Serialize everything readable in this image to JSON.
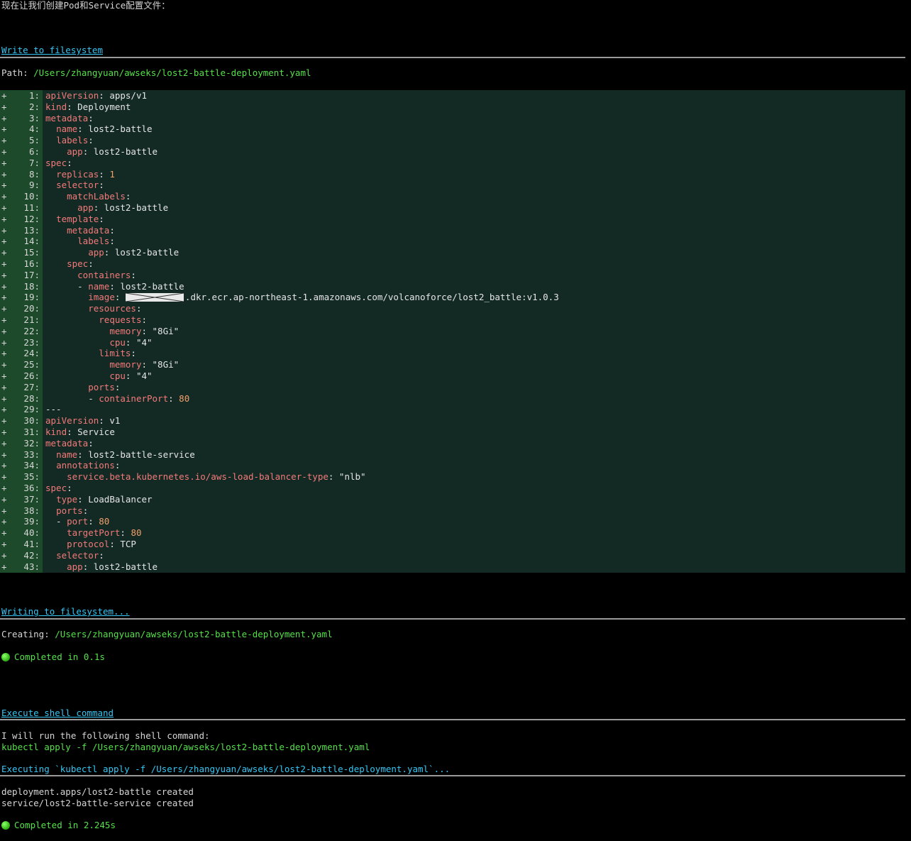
{
  "intro": "现在让我们创建Pod和Service配置文件：",
  "write": {
    "header": "Write to filesystem",
    "path_label": "Path: ",
    "path": "/Users/zhangyuan/awseks/lost2-battle-deployment.yaml"
  },
  "code_lines": [
    {
      "n": "1:",
      "t": [
        [
          "k",
          "apiVersion"
        ],
        [
          "v",
          ": apps/v1"
        ]
      ]
    },
    {
      "n": "2:",
      "t": [
        [
          "k",
          "kind"
        ],
        [
          "v",
          ": Deployment"
        ]
      ]
    },
    {
      "n": "3:",
      "t": [
        [
          "k",
          "metadata"
        ],
        [
          "v",
          ":"
        ]
      ]
    },
    {
      "n": "4:",
      "t": [
        [
          "v",
          "  "
        ],
        [
          "k",
          "name"
        ],
        [
          "v",
          ": lost2-battle"
        ]
      ]
    },
    {
      "n": "5:",
      "t": [
        [
          "v",
          "  "
        ],
        [
          "k",
          "labels"
        ],
        [
          "v",
          ":"
        ]
      ]
    },
    {
      "n": "6:",
      "t": [
        [
          "v",
          "    "
        ],
        [
          "k",
          "app"
        ],
        [
          "v",
          ": lost2-battle"
        ]
      ]
    },
    {
      "n": "7:",
      "t": [
        [
          "k",
          "spec"
        ],
        [
          "v",
          ":"
        ]
      ]
    },
    {
      "n": "8:",
      "t": [
        [
          "v",
          "  "
        ],
        [
          "k",
          "replicas"
        ],
        [
          "v",
          ": "
        ],
        [
          "n",
          "1"
        ]
      ]
    },
    {
      "n": "9:",
      "t": [
        [
          "v",
          "  "
        ],
        [
          "k",
          "selector"
        ],
        [
          "v",
          ":"
        ]
      ]
    },
    {
      "n": "10:",
      "t": [
        [
          "v",
          "    "
        ],
        [
          "k",
          "matchLabels"
        ],
        [
          "v",
          ":"
        ]
      ]
    },
    {
      "n": "11:",
      "t": [
        [
          "v",
          "      "
        ],
        [
          "k",
          "app"
        ],
        [
          "v",
          ": lost2-battle"
        ]
      ]
    },
    {
      "n": "12:",
      "t": [
        [
          "v",
          "  "
        ],
        [
          "k",
          "template"
        ],
        [
          "v",
          ":"
        ]
      ]
    },
    {
      "n": "13:",
      "t": [
        [
          "v",
          "    "
        ],
        [
          "k",
          "metadata"
        ],
        [
          "v",
          ":"
        ]
      ]
    },
    {
      "n": "14:",
      "t": [
        [
          "v",
          "      "
        ],
        [
          "k",
          "labels"
        ],
        [
          "v",
          ":"
        ]
      ]
    },
    {
      "n": "15:",
      "t": [
        [
          "v",
          "        "
        ],
        [
          "k",
          "app"
        ],
        [
          "v",
          ": lost2-battle"
        ]
      ]
    },
    {
      "n": "16:",
      "t": [
        [
          "v",
          "    "
        ],
        [
          "k",
          "spec"
        ],
        [
          "v",
          ":"
        ]
      ]
    },
    {
      "n": "17:",
      "t": [
        [
          "v",
          "      "
        ],
        [
          "k",
          "containers"
        ],
        [
          "v",
          ":"
        ]
      ]
    },
    {
      "n": "18:",
      "t": [
        [
          "v",
          "      - "
        ],
        [
          "k",
          "name"
        ],
        [
          "v",
          ": lost2-battle"
        ]
      ]
    },
    {
      "n": "19:",
      "t": [
        [
          "v",
          "        "
        ],
        [
          "k",
          "image"
        ],
        [
          "v",
          ": "
        ],
        [
          "r",
          ""
        ],
        [
          "v",
          ".dkr.ecr.ap-northeast-1.amazonaws.com/volcanoforce/lost2_battle:v1.0.3"
        ]
      ]
    },
    {
      "n": "20:",
      "t": [
        [
          "v",
          "        "
        ],
        [
          "k",
          "resources"
        ],
        [
          "v",
          ":"
        ]
      ]
    },
    {
      "n": "21:",
      "t": [
        [
          "v",
          "          "
        ],
        [
          "k",
          "requests"
        ],
        [
          "v",
          ":"
        ]
      ]
    },
    {
      "n": "22:",
      "t": [
        [
          "v",
          "            "
        ],
        [
          "k",
          "memory"
        ],
        [
          "v",
          ": \"8Gi\""
        ]
      ]
    },
    {
      "n": "23:",
      "t": [
        [
          "v",
          "            "
        ],
        [
          "k",
          "cpu"
        ],
        [
          "v",
          ": \"4\""
        ]
      ]
    },
    {
      "n": "24:",
      "t": [
        [
          "v",
          "          "
        ],
        [
          "k",
          "limits"
        ],
        [
          "v",
          ":"
        ]
      ]
    },
    {
      "n": "25:",
      "t": [
        [
          "v",
          "            "
        ],
        [
          "k",
          "memory"
        ],
        [
          "v",
          ": \"8Gi\""
        ]
      ]
    },
    {
      "n": "26:",
      "t": [
        [
          "v",
          "            "
        ],
        [
          "k",
          "cpu"
        ],
        [
          "v",
          ": \"4\""
        ]
      ]
    },
    {
      "n": "27:",
      "t": [
        [
          "v",
          "        "
        ],
        [
          "k",
          "ports"
        ],
        [
          "v",
          ":"
        ]
      ]
    },
    {
      "n": "28:",
      "t": [
        [
          "v",
          "        - "
        ],
        [
          "k",
          "containerPort"
        ],
        [
          "v",
          ": "
        ],
        [
          "n",
          "80"
        ]
      ]
    },
    {
      "n": "29:",
      "t": [
        [
          "v",
          "---"
        ]
      ]
    },
    {
      "n": "30:",
      "t": [
        [
          "k",
          "apiVersion"
        ],
        [
          "v",
          ": v1"
        ]
      ]
    },
    {
      "n": "31:",
      "t": [
        [
          "k",
          "kind"
        ],
        [
          "v",
          ": Service"
        ]
      ]
    },
    {
      "n": "32:",
      "t": [
        [
          "k",
          "metadata"
        ],
        [
          "v",
          ":"
        ]
      ]
    },
    {
      "n": "33:",
      "t": [
        [
          "v",
          "  "
        ],
        [
          "k",
          "name"
        ],
        [
          "v",
          ": lost2-battle-service"
        ]
      ]
    },
    {
      "n": "34:",
      "t": [
        [
          "v",
          "  "
        ],
        [
          "k",
          "annotations"
        ],
        [
          "v",
          ":"
        ]
      ]
    },
    {
      "n": "35:",
      "t": [
        [
          "v",
          "    "
        ],
        [
          "k",
          "service.beta.kubernetes.io/aws-load-balancer-type"
        ],
        [
          "v",
          ": \"nlb\""
        ]
      ]
    },
    {
      "n": "36:",
      "t": [
        [
          "k",
          "spec"
        ],
        [
          "v",
          ":"
        ]
      ]
    },
    {
      "n": "37:",
      "t": [
        [
          "v",
          "  "
        ],
        [
          "k",
          "type"
        ],
        [
          "v",
          ": LoadBalancer"
        ]
      ]
    },
    {
      "n": "38:",
      "t": [
        [
          "v",
          "  "
        ],
        [
          "k",
          "ports"
        ],
        [
          "v",
          ":"
        ]
      ]
    },
    {
      "n": "39:",
      "t": [
        [
          "v",
          "  - "
        ],
        [
          "k",
          "port"
        ],
        [
          "v",
          ": "
        ],
        [
          "n",
          "80"
        ]
      ]
    },
    {
      "n": "40:",
      "t": [
        [
          "v",
          "    "
        ],
        [
          "k",
          "targetPort"
        ],
        [
          "v",
          ": "
        ],
        [
          "n",
          "80"
        ]
      ]
    },
    {
      "n": "41:",
      "t": [
        [
          "v",
          "    "
        ],
        [
          "k",
          "protocol"
        ],
        [
          "v",
          ": TCP"
        ]
      ]
    },
    {
      "n": "42:",
      "t": [
        [
          "v",
          "  "
        ],
        [
          "k",
          "selector"
        ],
        [
          "v",
          ":"
        ]
      ]
    },
    {
      "n": "43:",
      "t": [
        [
          "v",
          "    "
        ],
        [
          "k",
          "app"
        ],
        [
          "v",
          ": lost2-battle"
        ]
      ]
    }
  ],
  "writing": {
    "header": "Writing to filesystem...",
    "creating_label": "Creating: ",
    "creating_path": "/Users/zhangyuan/awseks/lost2-battle-deployment.yaml",
    "completed": "Completed in 0.1s"
  },
  "exec": {
    "header": "Execute shell command",
    "intro": "I will run the following shell command:",
    "command": "kubectl apply -f /Users/zhangyuan/awseks/lost2-battle-deployment.yaml",
    "executing": "Executing `kubectl apply -f /Users/zhangyuan/awseks/lost2-battle-deployment.yaml`...",
    "output1": "deployment.apps/lost2-battle created",
    "output2": "service/lost2-battle-service created",
    "completed": "Completed in 2.245s"
  },
  "colors": {
    "header": "#35c6f4",
    "path": "#55e14a",
    "key": "#f47a7a",
    "number": "#f2a06a",
    "code_bg": "#132a24",
    "gutter_bg": "#1c4a2b"
  }
}
